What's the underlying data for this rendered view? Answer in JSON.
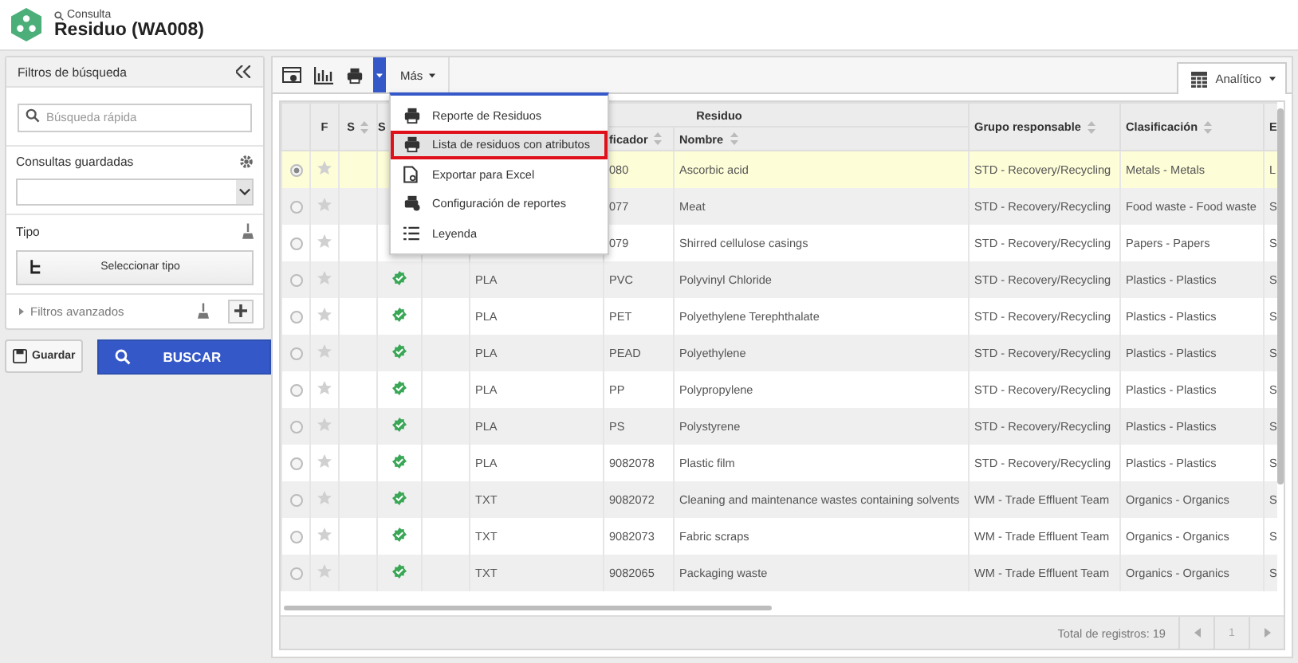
{
  "header": {
    "breadcrumb": "Consulta",
    "title": "Residuo (WA008)"
  },
  "sidebar": {
    "title": "Filtros de búsqueda",
    "search_placeholder": "Búsqueda rápida",
    "saved_label": "Consultas guardadas",
    "type_label": "Tipo",
    "type_button": "Seleccionar tipo",
    "advanced_label": "Filtros avanzados",
    "save_button": "Guardar",
    "search_button": "BUSCAR"
  },
  "toolbar": {
    "more_label": "Más",
    "view_label": "Analítico"
  },
  "menu": {
    "items": [
      {
        "kind": "printer",
        "label": "Reporte de Residuos",
        "highlighted": false
      },
      {
        "kind": "printer",
        "label": "Lista de residuos con atributos",
        "highlighted": true
      },
      {
        "kind": "document",
        "label": "Exportar para Excel",
        "highlighted": false
      },
      {
        "kind": "printer-gear",
        "label": "Configuración de reportes",
        "highlighted": false
      },
      {
        "kind": "list",
        "label": "Leyenda",
        "highlighted": false
      }
    ]
  },
  "table": {
    "headers": {
      "f": "F",
      "s1": "S",
      "s2": "S",
      "group": "Residuo",
      "code": "ficador",
      "name": "Nombre",
      "responsible": "Grupo responsable",
      "classification": "Clasificación",
      "e": "E"
    },
    "rows": [
      {
        "selected": true,
        "code": "080",
        "name": "Ascorbic acid",
        "responsible": "STD - Recovery/Recycling",
        "classification": "Metals - Metals",
        "e": "L"
      },
      {
        "selected": false,
        "code": "077",
        "name": "Meat",
        "responsible": "STD - Recovery/Recycling",
        "classification": "Food waste - Food waste",
        "e": "S"
      },
      {
        "selected": false,
        "code": "079",
        "name": "Shirred cellulose casings",
        "responsible": "STD - Recovery/Recycling",
        "classification": "Papers - Papers",
        "e": "S"
      },
      {
        "selected": false,
        "approved": true,
        "type": "PLA",
        "code": "PVC",
        "name": "Polyvinyl Chloride",
        "responsible": "STD - Recovery/Recycling",
        "classification": "Plastics - Plastics",
        "e": "S"
      },
      {
        "selected": false,
        "approved": true,
        "type": "PLA",
        "code": "PET",
        "name": "Polyethylene Terephthalate",
        "responsible": "STD - Recovery/Recycling",
        "classification": "Plastics - Plastics",
        "e": "S"
      },
      {
        "selected": false,
        "approved": true,
        "type": "PLA",
        "code": "PEAD",
        "name": "Polyethylene",
        "responsible": "STD - Recovery/Recycling",
        "classification": "Plastics - Plastics",
        "e": "S"
      },
      {
        "selected": false,
        "approved": true,
        "type": "PLA",
        "code": "PP",
        "name": "Polypropylene",
        "responsible": "STD - Recovery/Recycling",
        "classification": "Plastics - Plastics",
        "e": "S"
      },
      {
        "selected": false,
        "approved": true,
        "type": "PLA",
        "code": "PS",
        "name": "Polystyrene",
        "responsible": "STD - Recovery/Recycling",
        "classification": "Plastics - Plastics",
        "e": "S"
      },
      {
        "selected": false,
        "approved": true,
        "type": "PLA",
        "code": "9082078",
        "name": "Plastic film",
        "responsible": "STD - Recovery/Recycling",
        "classification": "Plastics - Plastics",
        "e": "S"
      },
      {
        "selected": false,
        "approved": true,
        "type": "TXT",
        "code": "9082072",
        "name": "Cleaning and maintenance wastes containing solvents",
        "responsible": "WM - Trade Effluent Team",
        "classification": "Organics - Organics",
        "e": "S"
      },
      {
        "selected": false,
        "approved": true,
        "type": "TXT",
        "code": "9082073",
        "name": "Fabric scraps",
        "responsible": "WM - Trade Effluent Team",
        "classification": "Organics - Organics",
        "e": "S"
      },
      {
        "selected": false,
        "approved": true,
        "type": "TXT",
        "code": "9082065",
        "name": "Packaging waste",
        "responsible": "WM - Trade Effluent Team",
        "classification": "Organics - Organics",
        "e": "S"
      }
    ]
  },
  "footer": {
    "total": "Total de registros: 19",
    "page": "1"
  }
}
